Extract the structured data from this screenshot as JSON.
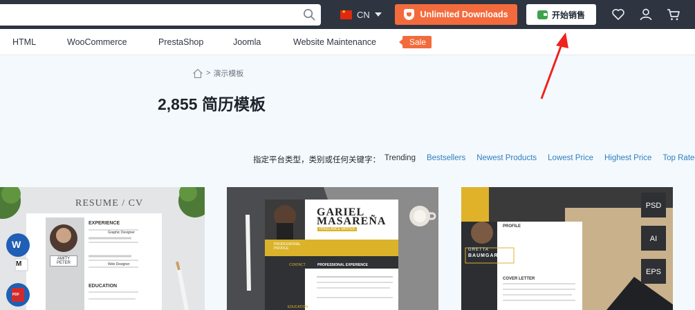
{
  "header": {
    "search": {
      "value": "",
      "placeholder": ""
    },
    "lang": {
      "label": "CN"
    },
    "unlimited_label": "Unlimited Downloads",
    "sell_label": "开始销售"
  },
  "nav": {
    "items": [
      "HTML",
      "WooCommerce",
      "PrestaShop",
      "Joomla",
      "Website Maintenance"
    ],
    "sale_label": "Sale"
  },
  "breadcrumb": {
    "sep": ">",
    "current": "演示模板"
  },
  "page_title": "2,855 简历模板",
  "sort": {
    "label": "指定平台类型，类别或任何关键字：",
    "options": [
      "Trending",
      "Bestsellers",
      "Newest Products",
      "Lowest Price",
      "Highest Price",
      "Top Rated"
    ]
  },
  "cards": [
    {
      "heading": "RESUME / CV",
      "name": "AMITY PETER",
      "sections": [
        "EXPERIENCE",
        "EDUCATION"
      ],
      "jobs": [
        "Graphic Designer",
        "Web Designer"
      ],
      "badges": [
        "W",
        "M",
        "PDF"
      ]
    },
    {
      "first": "GARIEL",
      "last": "MASAREÑA",
      "role": "FREELANCE WRITER",
      "sections": [
        "PROFESSIONAL PROFILE",
        "CONTACT",
        "PROFESSIONAL EXPERIENCE",
        "EDUCATION"
      ]
    },
    {
      "name_top": "GRETTA",
      "name": "BAUMGARTNER",
      "sections": [
        "PROFILE",
        "COVER LETTER"
      ],
      "badges": [
        "PSD",
        "AI",
        "EPS"
      ]
    }
  ],
  "colors": {
    "accent": "#f36b3c",
    "topbar": "#2e3440",
    "link": "#2d7fc1",
    "gold": "#e6b923"
  }
}
